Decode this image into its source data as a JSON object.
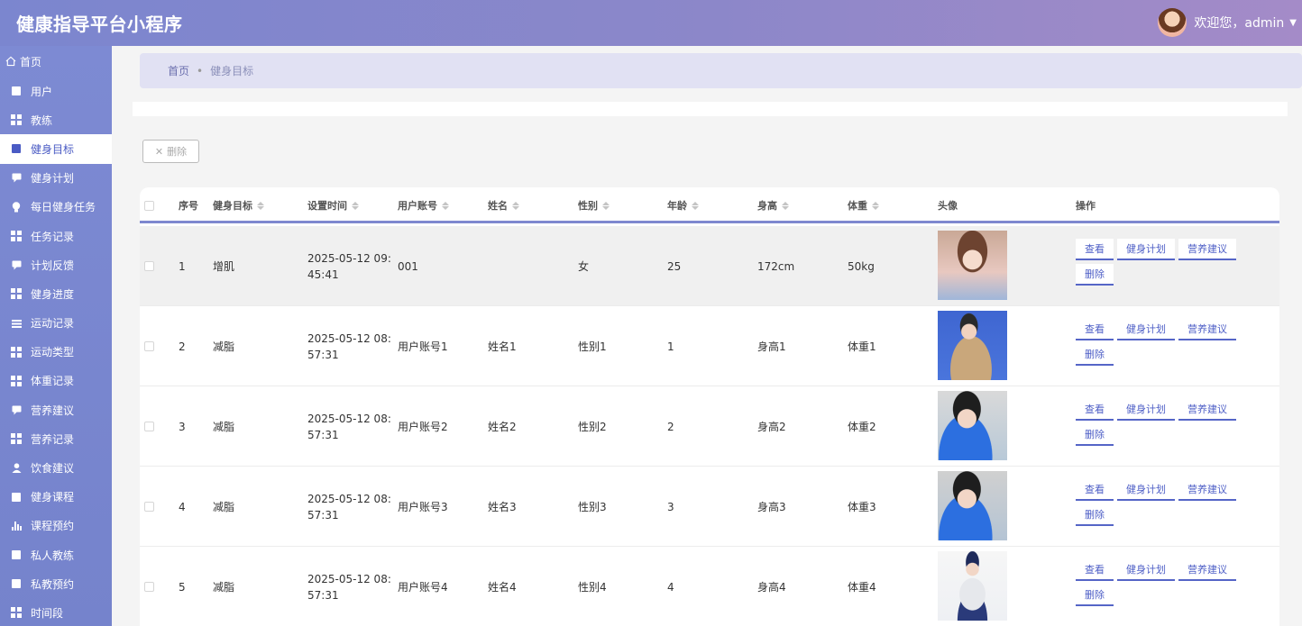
{
  "header": {
    "app_title": "健康指导平台小程序",
    "welcome": "欢迎您，admin"
  },
  "sidebar": {
    "home": "首页",
    "items": [
      {
        "label": "用户",
        "icon": "clipboard-icon"
      },
      {
        "label": "教练",
        "icon": "grid-icon"
      },
      {
        "label": "健身目标",
        "icon": "briefcase-icon",
        "active": true
      },
      {
        "label": "健身计划",
        "icon": "chat-icon"
      },
      {
        "label": "每日健身任务",
        "icon": "bulb-icon"
      },
      {
        "label": "任务记录",
        "icon": "grid-icon"
      },
      {
        "label": "计划反馈",
        "icon": "comment-icon"
      },
      {
        "label": "健身进度",
        "icon": "table-icon"
      },
      {
        "label": "运动记录",
        "icon": "list-icon"
      },
      {
        "label": "运动类型",
        "icon": "grid-icon"
      },
      {
        "label": "体重记录",
        "icon": "grid-icon"
      },
      {
        "label": "营养建议",
        "icon": "comment-icon"
      },
      {
        "label": "营养记录",
        "icon": "grid-icon"
      },
      {
        "label": "饮食建议",
        "icon": "user-icon"
      },
      {
        "label": "健身课程",
        "icon": "calendar-icon"
      },
      {
        "label": "课程预约",
        "icon": "bar-chart-icon"
      },
      {
        "label": "私人教练",
        "icon": "wallet-icon"
      },
      {
        "label": "私教预约",
        "icon": "chart-icon"
      },
      {
        "label": "时间段",
        "icon": "grid-icon"
      }
    ]
  },
  "breadcrumb": {
    "home": "首页",
    "separator": "•",
    "current": "健身目标"
  },
  "toolbar": {
    "delete_label": "删除"
  },
  "table": {
    "columns": [
      "序号",
      "健身目标",
      "设置时间",
      "用户账号",
      "姓名",
      "性别",
      "年龄",
      "身高",
      "体重",
      "头像",
      "操作"
    ],
    "rows": [
      {
        "idx": "1",
        "goal": "增肌",
        "time": "2025-05-12 09:45:41",
        "account": "001",
        "name": "",
        "gender": "女",
        "age": "25",
        "height": "172cm",
        "weight": "50kg"
      },
      {
        "idx": "2",
        "goal": "减脂",
        "time": "2025-05-12 08:57:31",
        "account": "用户账号1",
        "name": "姓名1",
        "gender": "性别1",
        "age": "1",
        "height": "身高1",
        "weight": "体重1"
      },
      {
        "idx": "3",
        "goal": "减脂",
        "time": "2025-05-12 08:57:31",
        "account": "用户账号2",
        "name": "姓名2",
        "gender": "性别2",
        "age": "2",
        "height": "身高2",
        "weight": "体重2"
      },
      {
        "idx": "4",
        "goal": "减脂",
        "time": "2025-05-12 08:57:31",
        "account": "用户账号3",
        "name": "姓名3",
        "gender": "性别3",
        "age": "3",
        "height": "身高3",
        "weight": "体重3"
      },
      {
        "idx": "5",
        "goal": "减脂",
        "time": "2025-05-12 08:57:31",
        "account": "用户账号4",
        "name": "姓名4",
        "gender": "性别4",
        "age": "4",
        "height": "身高4",
        "weight": "体重4"
      }
    ],
    "actions": [
      "查看",
      "健身计划",
      "营养建议",
      "删除"
    ]
  },
  "colors": {
    "accent": "#5565c7",
    "sidebar": "#7d8ad3",
    "header_start": "#7b86cf",
    "header_end": "#a48bc8"
  }
}
